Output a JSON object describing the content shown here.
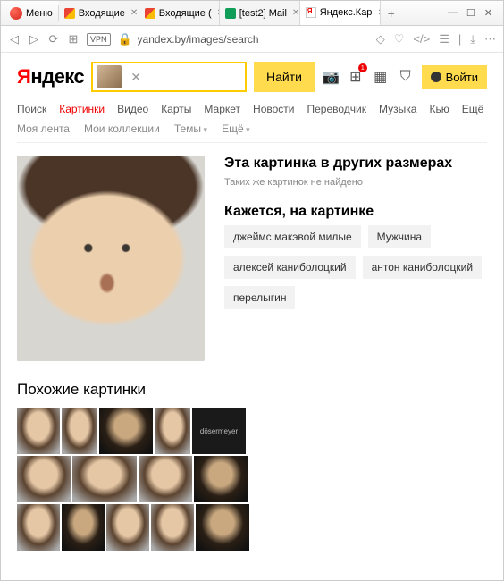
{
  "titlebar": {
    "menu_label": "Меню",
    "tabs": [
      {
        "label": "Входящие"
      },
      {
        "label": "Входящие ("
      },
      {
        "label": "[test2] Mail"
      },
      {
        "label": "Яндекс.Кар"
      }
    ],
    "close_glyph": "✕",
    "newtab_glyph": "+",
    "win_min": "—",
    "win_max": "☐",
    "win_close": "✕"
  },
  "addressbar": {
    "back": "◁",
    "fwd": "▷",
    "reload": "⟳",
    "speed": "⊞",
    "vpn": "VPN",
    "lock": "🔒",
    "url": "yandex.by/images/search",
    "icons": {
      "bookmark": "◇",
      "heart": "♡",
      "code": "</>",
      "settings": "☰",
      "sep": "|",
      "download": "⤓",
      "more": "⋯"
    }
  },
  "header": {
    "logo_y": "Я",
    "logo_rest": "ндекс",
    "clear": "✕",
    "search_btn": "Найти",
    "camera": "📷",
    "apps": "⊞",
    "apps_badge": "1",
    "cube": "▦",
    "shield": "⛉",
    "login": "Войти"
  },
  "services": [
    "Поиск",
    "Картинки",
    "Видео",
    "Карты",
    "Маркет",
    "Новости",
    "Переводчик",
    "Музыка",
    "Кью",
    "Ещё"
  ],
  "services_active_index": 1,
  "subnav": {
    "feed": "Моя лента",
    "coll": "Мои коллекции",
    "themes": "Темы",
    "more": "Ещё"
  },
  "side": {
    "title1": "Эта картинка в других размерах",
    "sub1": "Таких же картинок не найдено",
    "title2": "Кажется, на картинке"
  },
  "tags": [
    "джеймс макэвой милые",
    "Мужчина",
    "алексей каниболоцкий",
    "антон каниболоцкий",
    "перелыгин"
  ],
  "similar_title": "Похожие картинки"
}
